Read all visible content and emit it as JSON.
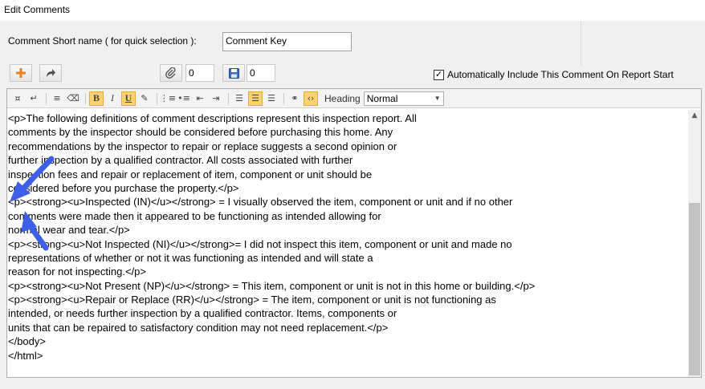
{
  "window": {
    "title": "Edit Comments"
  },
  "form": {
    "short_name_label": "Comment Short name ( for quick selection ):",
    "short_name_value": "Comment Key"
  },
  "toolbar": {
    "attach_count": "0",
    "save_count": "0",
    "auto_include_label": "Automatically Include This Comment On Report Start",
    "auto_include_checked": "✓"
  },
  "editor_toolbar": {
    "heading_label": "Heading",
    "heading_value": "Normal",
    "bold": "B",
    "italic": "I",
    "underline": "U"
  },
  "code_lines": [
    "<p>The following definitions of comment descriptions represent this inspection report. All",
    "comments by the inspector should be considered before purchasing this home. Any",
    "recommendations by the inspector to repair or replace suggests a second opinion or",
    "further inspection by a qualified contractor. All costs associated with further",
    "inspection fees and repair or replacement of item, component or unit should be",
    "considered before you purchase the property.</p>",
    "<p><strong><u>Inspected (IN)</u></strong> = I visually observed the item, component or unit and if no other",
    "comments were made then it appeared to be functioning as intended allowing for",
    "normal wear and tear.</p>",
    "<p><strong><u>Not Inspected (NI)</u></strong>= I did not inspect this item, component or unit and made no",
    "representations of whether or not it was functioning as intended and will state a",
    "reason for not inspecting.</p>",
    "<p><strong><u>Not Present (NP)</u></strong> = This item, component or unit is not in this home or building.</p>",
    "<p><strong><u>Repair or Replace (RR)</u></strong> = The item, component or unit is not functioning as",
    "intended, or needs further inspection by a qualified contractor. Items, components or",
    "units that can be repaired to satisfactory condition may not need replacement.</p>",
    "</body>",
    "</html>"
  ],
  "colors": {
    "accent_active": "#ffd36b",
    "arrow": "#3d5fe8",
    "add_icon": "#e8821e"
  }
}
